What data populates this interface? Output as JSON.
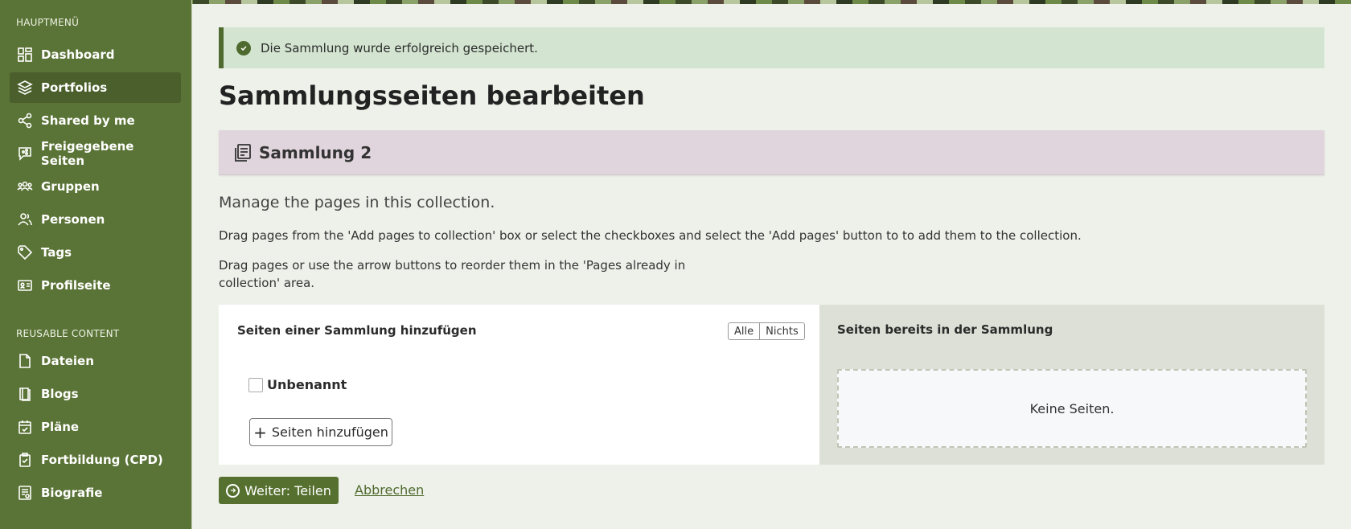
{
  "sidebar": {
    "main_heading": "HAUPTMENÜ",
    "items": [
      {
        "label": "Dashboard",
        "icon": "dashboard-icon"
      },
      {
        "label": "Portfolios",
        "icon": "layers-icon",
        "active": true
      },
      {
        "label": "Shared by me",
        "icon": "share-icon"
      },
      {
        "label": "Freigegebene Seiten",
        "icon": "shared-pages-icon"
      },
      {
        "label": "Gruppen",
        "icon": "groups-icon"
      },
      {
        "label": "Personen",
        "icon": "people-icon"
      },
      {
        "label": "Tags",
        "icon": "tag-icon"
      },
      {
        "label": "Profilseite",
        "icon": "profile-card-icon"
      }
    ],
    "reusable_heading": "REUSABLE CONTENT",
    "reusable_items": [
      {
        "label": "Dateien",
        "icon": "file-icon"
      },
      {
        "label": "Blogs",
        "icon": "blog-icon"
      },
      {
        "label": "Pläne",
        "icon": "calendar-check-icon"
      },
      {
        "label": "Fortbildung (CPD)",
        "icon": "clipboard-icon"
      },
      {
        "label": "Biografie",
        "icon": "resume-icon"
      }
    ]
  },
  "alert": {
    "message": "Die Sammlung wurde erfolgreich gespeichert.",
    "icon": "check-circle-icon"
  },
  "page_title": "Sammlungsseiten bearbeiten",
  "collection": {
    "title": "Sammlung 2",
    "icon": "collection-icon"
  },
  "lead": "Manage the pages in this collection.",
  "instructions": {
    "p1": "Drag pages from the 'Add pages to collection' box or select the checkboxes and select the 'Add pages' button to to add them to the collection.",
    "p2_line1": "Drag pages or use the arrow buttons to reorder them in the 'Pages already in",
    "p2_line2": "collection' area."
  },
  "add_panel": {
    "title": "Seiten einer Sammlung hinzufügen",
    "select_all": "Alle",
    "select_none": "Nichts",
    "pages": [
      {
        "label": "Unbenannt",
        "checked": false
      }
    ],
    "add_button": "Seiten hinzufügen"
  },
  "existing_panel": {
    "title": "Seiten bereits in der Sammlung",
    "empty_text": "Keine Seiten."
  },
  "actions": {
    "next_button": "Weiter: Teilen",
    "cancel_link": "Abbrechen"
  },
  "colors": {
    "sidebar_bg": "#5a7336",
    "accent": "#56702f",
    "alert_bg": "#d3e5d1",
    "collection_bar_bg": "#e0d5dc",
    "page_bg": "#eef1ea"
  }
}
